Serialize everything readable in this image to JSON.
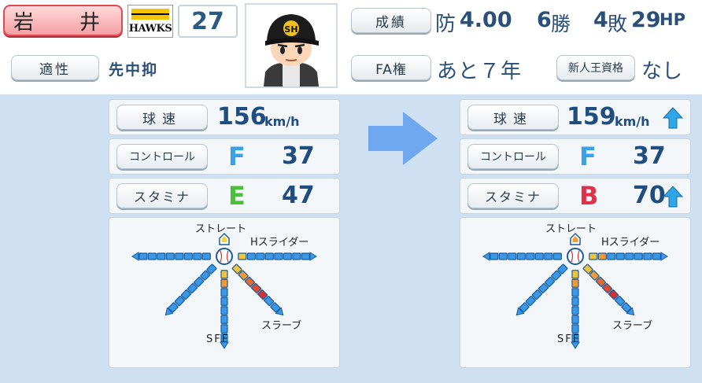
{
  "player": {
    "name": "岩　井",
    "team_logo_text": "HAWKS",
    "number": "27"
  },
  "aptitude": {
    "label": "適性",
    "value": "先中抑"
  },
  "record": {
    "label": "成績",
    "era_prefix": "防",
    "era": "4.00",
    "wins": "6",
    "wins_unit": "勝",
    "losses": "4",
    "losses_unit": "敗",
    "hp": "29",
    "hp_unit": "HP"
  },
  "fa": {
    "label": "FA権",
    "value": "あと７年"
  },
  "rookie": {
    "label": "新人王資格",
    "value": "なし"
  },
  "arrow_icon": "right-arrow-icon",
  "before": {
    "speed": {
      "label": "球速",
      "value": "156",
      "unit": "km/h"
    },
    "control": {
      "label": "コントロール",
      "grade": "F",
      "value": "37",
      "grade_color": "#3aa0e8"
    },
    "stamina": {
      "label": "スタミナ",
      "grade": "E",
      "value": "47",
      "grade_color": "#4cbf3a"
    },
    "pitches": {
      "straight": "ストレート",
      "slider": "Hスライダー",
      "slurve": "スラーブ",
      "sff": "SFF",
      "slider_level": 1,
      "slurve_level": 5,
      "sff_level": 2
    }
  },
  "after": {
    "speed": {
      "label": "球速",
      "value": "159",
      "unit": "km/h"
    },
    "control": {
      "label": "コントロール",
      "grade": "F",
      "value": "37",
      "grade_color": "#3aa0e8"
    },
    "stamina": {
      "label": "スタミナ",
      "grade": "B",
      "value": "70",
      "grade_color": "#e0304a"
    },
    "pitches": {
      "straight": "ストレート",
      "slider": "Hスライダー",
      "slurve": "スラーブ",
      "sff": "SFF",
      "slider_level": 2,
      "slurve_level": 5,
      "sff_level": 2
    }
  },
  "colors": {
    "value_text": "#1f4d80",
    "up_arrow": "#2fa6e8",
    "panel_bg": "#cfe0f2",
    "name_bg": "#f5a0a4"
  }
}
